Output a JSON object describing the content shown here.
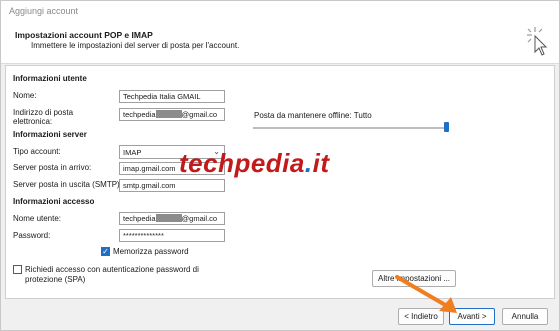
{
  "window": {
    "title": "Aggiungi account"
  },
  "header": {
    "title": "Impostazioni account POP e IMAP",
    "subtitle": "Immettere le impostazioni del server di posta per l'account."
  },
  "user_info": {
    "section": "Informazioni utente",
    "name_label": "Nome:",
    "name_value": "Techpedia Italia GMAIL",
    "email_label_1": "Indirizzo di posta",
    "email_label_2": "elettronica:",
    "email_prefix": "techpedia",
    "email_suffix": "@gmail.co"
  },
  "server_info": {
    "section": "Informazioni server",
    "account_type_label": "Tipo account:",
    "account_type_value": "IMAP",
    "incoming_label": "Server posta in arrivo:",
    "incoming_value": "imap.gmail.com",
    "outgoing_label": "Server posta in uscita (SMTP):",
    "outgoing_value": "smtp.gmail.com"
  },
  "login_info": {
    "section": "Informazioni accesso",
    "username_label": "Nome utente:",
    "username_prefix": "techpedia",
    "username_suffix": "@gmail.co",
    "password_label": "Password:",
    "password_value": "**************",
    "remember_label": "Memorizza password",
    "remember_checked": true,
    "spa_label_1": "Richiedi accesso con autenticazione password di",
    "spa_label_2": "protezione (SPA)",
    "spa_checked": false
  },
  "offline": {
    "label": "Posta da mantenere offline:",
    "value": "Tutto",
    "slider_level": 1.0
  },
  "buttons": {
    "more_settings": "Altre impostazioni ...",
    "back": "< Indietro",
    "next": "Avanti >",
    "cancel": "Annulla"
  },
  "watermark": {
    "main": "techpedia",
    "dot": ".",
    "tld": "it"
  },
  "colors": {
    "accent": "#1f6fc6",
    "watermark": "#c21a1a",
    "arrow": "#f07d1e"
  }
}
